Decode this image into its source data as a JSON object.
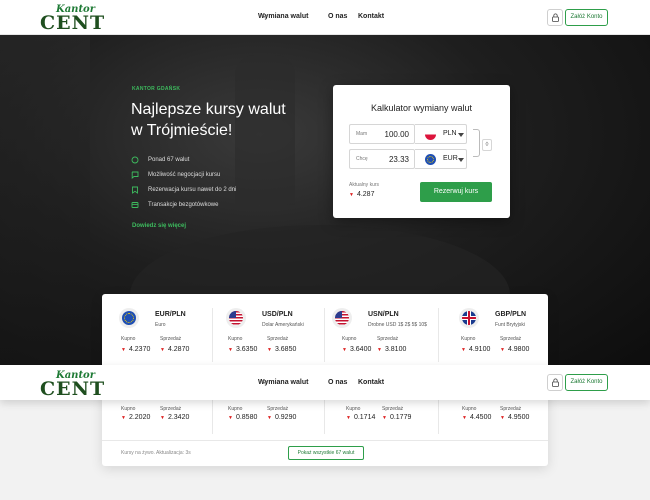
{
  "brand": {
    "script": "Kantor",
    "main": "CENT"
  },
  "nav": {
    "items": [
      {
        "label": "Wymiana walut"
      },
      {
        "label": "O nas"
      },
      {
        "label": "Kontakt"
      }
    ],
    "account_label": "Załóż Konto"
  },
  "hero": {
    "eyebrow": "KANTOR GDAŃSK",
    "title_line1": "Najlepsze kursy walut",
    "title_line2": "w Trójmieście!",
    "features": [
      "Ponad 67 walut",
      "Możliwość negocjacji kursu",
      "Rezerwacja kursu nawet do 2 dni",
      "Transakcje bezgotówkowe"
    ],
    "more_link": "Dowiedz się więcej"
  },
  "calculator": {
    "title": "Kalkulator wymiany walut",
    "have_label": "Mam",
    "have_value": "100.00",
    "have_currency": "PLN",
    "want_label": "Chcę",
    "want_value": "23.33",
    "want_currency": "EUR",
    "rate_label": "Aktualny kurs",
    "rate_value": "4.287",
    "reserve_button": "Rezerwuj kurs",
    "swap_symbol": "◊"
  },
  "rates": {
    "buy_label": "Kupno",
    "sell_label": "Sprzedaż",
    "top": [
      {
        "pair": "EUR/PLN",
        "name": "Euro",
        "buy": "4.2370",
        "sell": "4.2870"
      },
      {
        "pair": "USD/PLN",
        "name": "Dolar Amerykański",
        "buy": "3.6350",
        "sell": "3.6850"
      },
      {
        "pair": "USN/PLN",
        "name": "Drobne USD 1$ 2$ 5$ 10$",
        "buy": "3.6400",
        "sell": "3.8100"
      },
      {
        "pair": "GBP/PLN",
        "name": "Funt Brytyjski",
        "buy": "4.9100",
        "sell": "4.9800"
      }
    ],
    "bottom": [
      {
        "buy": "2.2020",
        "sell": "2.3420"
      },
      {
        "buy": "0.8580",
        "sell": "0.9290"
      },
      {
        "buy": "0.1714",
        "sell": "0.1779"
      },
      {
        "buy": "4.4500",
        "sell": "4.9500"
      }
    ],
    "live_note": "Kursy na żywo. Aktualizacja: 3s",
    "show_all_button": "Pokaż wszystkie 67 walut"
  },
  "icons": {
    "trend_down": "▼"
  },
  "colors": {
    "accent": "#2e9e4a",
    "down": "#dd2222"
  }
}
